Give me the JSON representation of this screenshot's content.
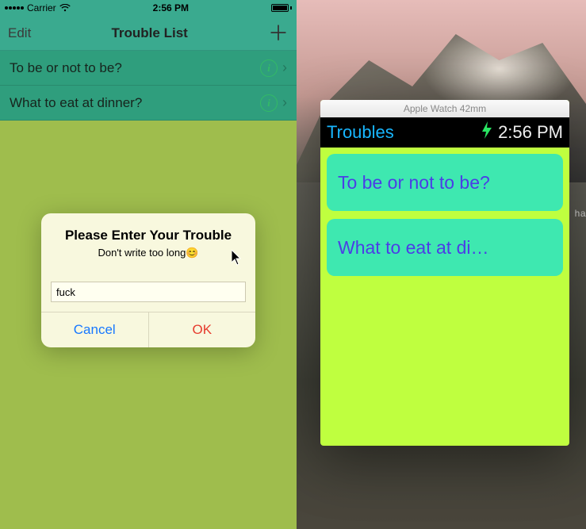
{
  "iphone": {
    "status": {
      "carrier": "Carrier",
      "time": "2:56 PM"
    },
    "nav": {
      "edit": "Edit",
      "title": "Trouble List"
    },
    "rows": [
      {
        "text": "To be or not to be?"
      },
      {
        "text": "What to eat at dinner?"
      }
    ],
    "alert": {
      "title": "Please Enter Your Trouble",
      "message": "Don't write too long😊",
      "input_value": "fuck",
      "cancel": "Cancel",
      "ok": "OK"
    }
  },
  "watch": {
    "window_title": "Apple Watch 42mm",
    "app_title": "Troubles",
    "time": "2:56 PM",
    "items": [
      {
        "text": "To be or not to be?"
      },
      {
        "text": "What to eat at di…"
      }
    ]
  },
  "desktop": {
    "edge_label": "ha"
  }
}
